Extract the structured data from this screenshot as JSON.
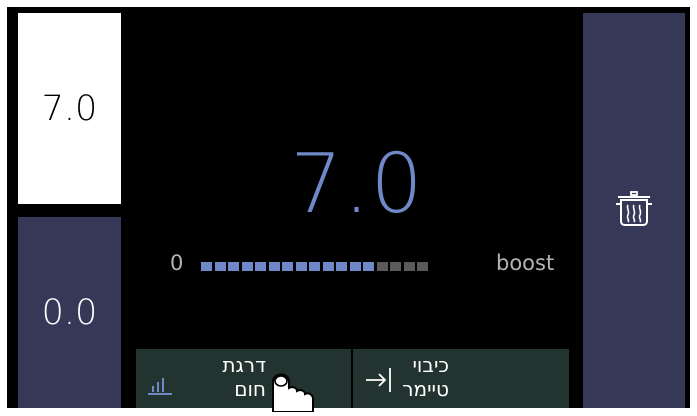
{
  "zones": {
    "active_value": "7.0",
    "inactive_value": "0.0"
  },
  "main": {
    "value": "7.0",
    "scale_min": "0",
    "scale_max": "boost",
    "level_segments_total": 17,
    "level_segments_on": 13
  },
  "buttons": {
    "heat_level": {
      "line1": "דרגת",
      "line2": "חום",
      "icon": "bar-levels-icon"
    },
    "timer_off": {
      "line1": "כיבוי",
      "line2": "טיימר",
      "icon": "timer-arrow-icon"
    }
  },
  "side_right": {
    "icon": "pot-icon"
  },
  "colors": {
    "accent": "#6f89c8",
    "panel": "#363858",
    "button": "#233330",
    "background": "#000000"
  }
}
